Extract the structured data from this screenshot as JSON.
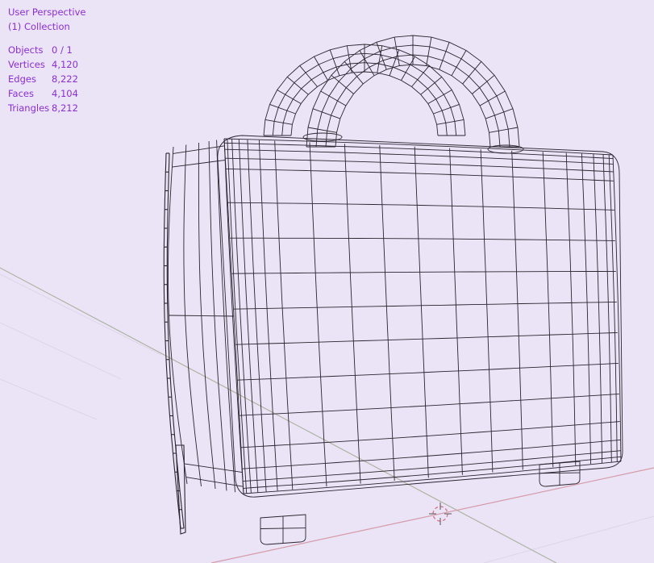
{
  "viewport": {
    "view_name": "User Perspective",
    "collection": "(1) Collection",
    "stats": [
      {
        "label": "Objects",
        "value": "0 / 1"
      },
      {
        "label": "Vertices",
        "value": "4,120"
      },
      {
        "label": "Edges",
        "value": "8,222"
      },
      {
        "label": "Faces",
        "value": "4,104"
      },
      {
        "label": "Triangles",
        "value": "8,212"
      }
    ]
  },
  "colors": {
    "background": "#ebe3f6",
    "overlay_text": "#8a2fd4",
    "wire": "#2a2530",
    "x_axis": "#d49ca8",
    "y_axis": "#aeb5a2",
    "grid": "#ddd5e8",
    "cursor": "#d97a88"
  },
  "icons": {
    "cursor": "3d-cursor-icon"
  }
}
